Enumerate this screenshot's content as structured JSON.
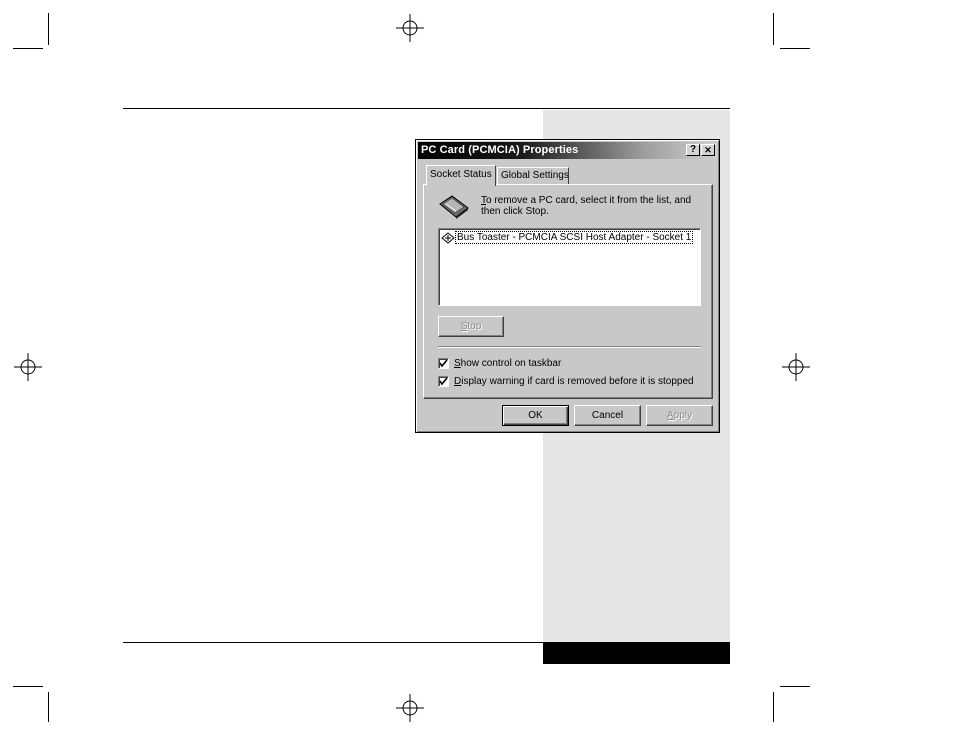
{
  "dialog": {
    "title": "PC Card (PCMCIA) Properties",
    "help_button": "?",
    "close_button": "✕",
    "tabs": [
      {
        "label": "Socket Status",
        "active": true
      },
      {
        "label": "Global Settings",
        "active": false
      }
    ],
    "instruction_mnemonic": "T",
    "instruction_rest": "o remove a PC card, select it from the list, and then click Stop.",
    "device_list": [
      {
        "label": "Bus Toaster - PCMCIA SCSI Host Adapter - Socket 1",
        "selected": true
      }
    ],
    "stop_button": {
      "mnemonic": "S",
      "rest": "top",
      "enabled": false
    },
    "checkboxes": [
      {
        "mnemonic": "S",
        "rest": "how control on taskbar",
        "checked": true
      },
      {
        "mnemonic": "D",
        "rest": "isplay warning if card is removed before it is stopped",
        "checked": true
      }
    ],
    "ok_button": "OK",
    "cancel_button": "Cancel",
    "apply_button": {
      "mnemonic": "A",
      "rest": "pply",
      "enabled": false
    }
  },
  "colors": {
    "dialog_face": "#c8c8c8",
    "sidebar": "#e6e6e6",
    "title_start": "#000000",
    "title_end": "#d0d0d0"
  }
}
